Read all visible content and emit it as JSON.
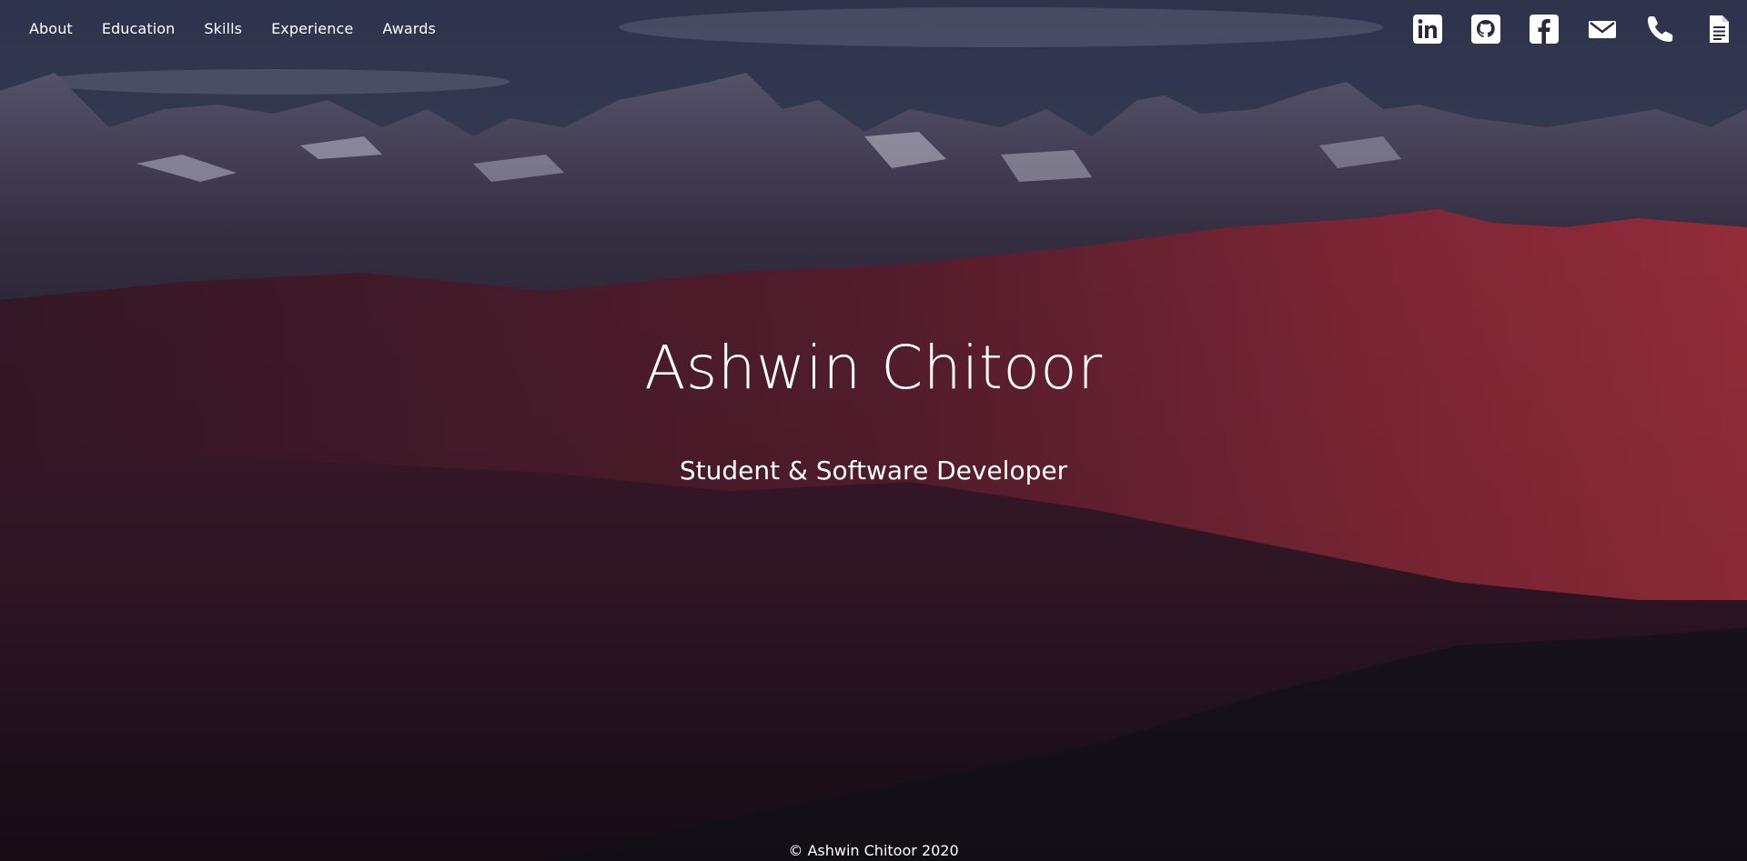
{
  "nav": {
    "links": [
      {
        "label": "About"
      },
      {
        "label": "Education"
      },
      {
        "label": "Skills"
      },
      {
        "label": "Experience"
      },
      {
        "label": "Awards"
      }
    ]
  },
  "social": {
    "icons": [
      "linkedin-icon",
      "github-icon",
      "facebook-icon",
      "email-icon",
      "phone-icon",
      "resume-icon"
    ]
  },
  "hero": {
    "title": "Ashwin Chitoor",
    "subtitle": "Student & Software Developer"
  },
  "footer": {
    "text": "© Ashwin Chitoor 2020"
  },
  "colors": {
    "text": "#ffffff",
    "sky": "#3d4560",
    "mountain_red": "#7a2233",
    "foreground_dark": "#1c1620"
  }
}
